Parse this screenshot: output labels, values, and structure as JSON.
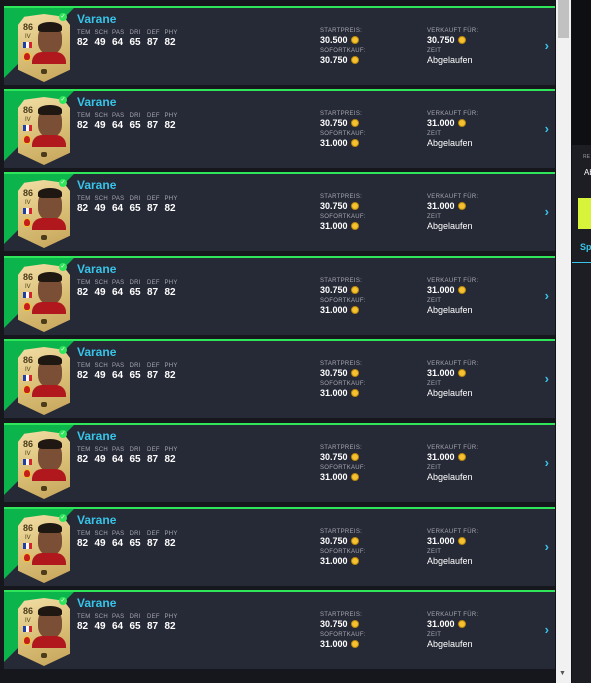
{
  "labels": {
    "startpreis": "STARTPREIS:",
    "sofortkauf": "SOFORTKAUF:",
    "verkauft": "VERKAUFT FÜR:",
    "zeit": "ZEIT",
    "stat_headers": [
      "TEM",
      "SCH",
      "PAS",
      "DRI",
      "DEF",
      "PHY"
    ]
  },
  "items": [
    {
      "name": "Varane",
      "rating": "86",
      "position": "IV",
      "stats": [
        "82",
        "49",
        "64",
        "65",
        "87",
        "82"
      ],
      "startpreis": "30.500",
      "sofortkauf": "30.750",
      "verkauft": "30.750",
      "zeit": "Abgelaufen"
    },
    {
      "name": "Varane",
      "rating": "86",
      "position": "IV",
      "stats": [
        "82",
        "49",
        "64",
        "65",
        "87",
        "82"
      ],
      "startpreis": "30.750",
      "sofortkauf": "31.000",
      "verkauft": "31.000",
      "zeit": "Abgelaufen"
    },
    {
      "name": "Varane",
      "rating": "86",
      "position": "IV",
      "stats": [
        "82",
        "49",
        "64",
        "65",
        "87",
        "82"
      ],
      "startpreis": "30.750",
      "sofortkauf": "31.000",
      "verkauft": "31.000",
      "zeit": "Abgelaufen"
    },
    {
      "name": "Varane",
      "rating": "86",
      "position": "IV",
      "stats": [
        "82",
        "49",
        "64",
        "65",
        "87",
        "82"
      ],
      "startpreis": "30.750",
      "sofortkauf": "31.000",
      "verkauft": "31.000",
      "zeit": "Abgelaufen"
    },
    {
      "name": "Varane",
      "rating": "86",
      "position": "IV",
      "stats": [
        "82",
        "49",
        "64",
        "65",
        "87",
        "82"
      ],
      "startpreis": "30.750",
      "sofortkauf": "31.000",
      "verkauft": "31.000",
      "zeit": "Abgelaufen"
    },
    {
      "name": "Varane",
      "rating": "86",
      "position": "IV",
      "stats": [
        "82",
        "49",
        "64",
        "65",
        "87",
        "82"
      ],
      "startpreis": "30.750",
      "sofortkauf": "31.000",
      "verkauft": "31.000",
      "zeit": "Abgelaufen"
    },
    {
      "name": "Varane",
      "rating": "86",
      "position": "IV",
      "stats": [
        "82",
        "49",
        "64",
        "65",
        "87",
        "82"
      ],
      "startpreis": "30.750",
      "sofortkauf": "31.000",
      "verkauft": "31.000",
      "zeit": "Abgelaufen"
    },
    {
      "name": "Varane",
      "rating": "86",
      "position": "IV",
      "stats": [
        "82",
        "49",
        "64",
        "65",
        "87",
        "82"
      ],
      "startpreis": "30.750",
      "sofortkauf": "31.000",
      "verkauft": "31.000",
      "zeit": "Abgelaufen"
    }
  ],
  "side_panel": {
    "small_label": "RE",
    "value": "Ab",
    "tab": "Sp"
  },
  "colors": {
    "accent": "#38c4e8",
    "row_bg": "#262936",
    "green": "#2fe65a",
    "lime": "#d7f33a"
  },
  "icons": [
    "chevron-right-icon",
    "coin-icon",
    "check-badge-icon",
    "flag-icon",
    "club-crest-icon"
  ]
}
